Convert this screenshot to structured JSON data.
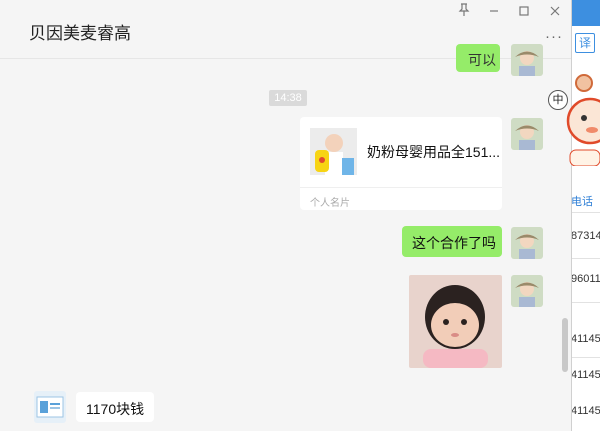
{
  "window": {
    "title": "贝因美麦睿高",
    "controls": {
      "pin_icon": "pin-icon",
      "minimize_icon": "minimize-icon",
      "maximize_icon": "maximize-icon",
      "close_icon": "close-icon"
    },
    "more_label": "···"
  },
  "chat": {
    "top_bubble_text": "可以",
    "timestamp": "14:38",
    "card": {
      "name": "奶粉母婴用品全151...",
      "footer": "个人名片"
    },
    "question": "这个合作了吗",
    "reply": "1170块钱"
  },
  "background_app": {
    "translate_label": "译",
    "input_lang_badge": "中",
    "link_text": "电话",
    "numbers": [
      "87314",
      "96011",
      "41145",
      "41145",
      "41145"
    ]
  },
  "colors": {
    "green_bubble": "#95ec69",
    "accent_blue": "#3d8fe0"
  }
}
